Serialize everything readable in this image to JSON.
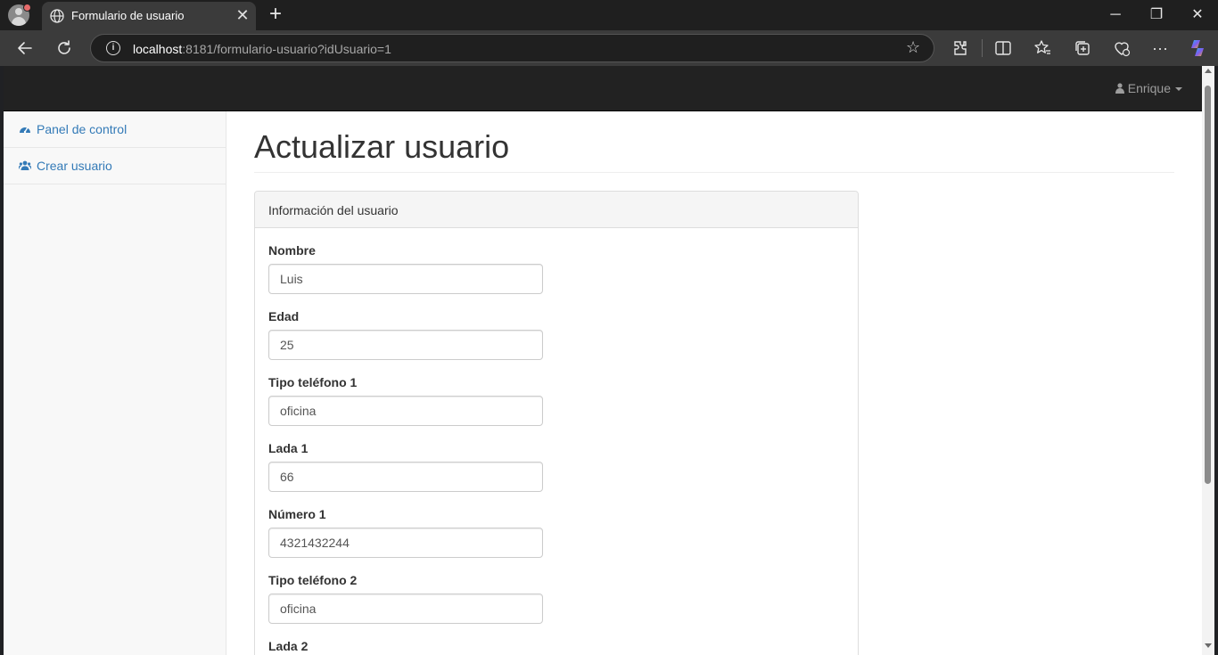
{
  "browser": {
    "tab_title": "Formulario de usuario",
    "url_host": "localhost",
    "url_rest": ":8181/formulario-usuario?idUsuario=1",
    "new_tab_glyph": "+",
    "close_glyph": "✕",
    "window_controls": [
      "─",
      "❐",
      "✕"
    ],
    "toolbar_icons": [
      "back-icon",
      "refresh-icon",
      "extensions-icon",
      "split-screen-icon",
      "favorites-icon",
      "collections-icon",
      "browser-essentials-icon",
      "more-icon",
      "copilot-icon"
    ]
  },
  "navbar": {
    "user_name": "Enrique"
  },
  "sidebar": {
    "items": [
      {
        "label": "Panel de control",
        "icon": "dashboard-icon"
      },
      {
        "label": "Crear usuario",
        "icon": "users-icon"
      }
    ]
  },
  "main": {
    "title": "Actualizar usuario",
    "panel_heading": "Información del usuario",
    "fields": [
      {
        "label": "Nombre",
        "value": "Luis"
      },
      {
        "label": "Edad",
        "value": "25"
      },
      {
        "label": "Tipo teléfono 1",
        "value": "oficina"
      },
      {
        "label": "Lada 1",
        "value": "66"
      },
      {
        "label": "Número 1",
        "value": "4321432244"
      },
      {
        "label": "Tipo teléfono 2",
        "value": "oficina"
      },
      {
        "label": "Lada 2",
        "value": ""
      }
    ]
  },
  "colors": {
    "link": "#337ab7",
    "navbar": "#222222",
    "chrome_dark": "#1f1f1f",
    "chrome_toolbar": "#3b3b3b"
  }
}
